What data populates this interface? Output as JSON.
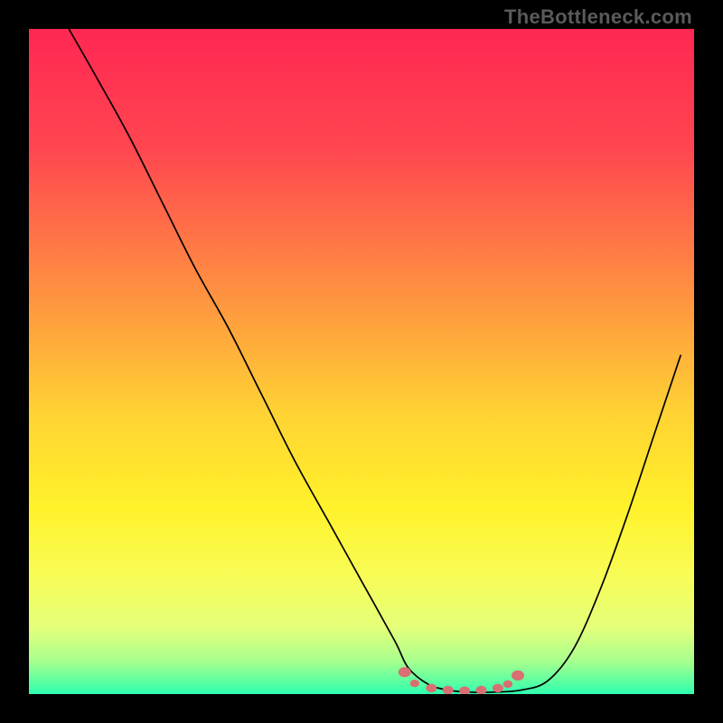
{
  "watermark": "TheBottleneck.com",
  "colors": {
    "gradient_stops": [
      {
        "pct": 0,
        "hex": "#ff2752"
      },
      {
        "pct": 18,
        "hex": "#ff4650"
      },
      {
        "pct": 38,
        "hex": "#ff8b42"
      },
      {
        "pct": 58,
        "hex": "#ffd333"
      },
      {
        "pct": 72,
        "hex": "#fff22a"
      },
      {
        "pct": 82,
        "hex": "#f8fc55"
      },
      {
        "pct": 90,
        "hex": "#e4ff7a"
      },
      {
        "pct": 95,
        "hex": "#a8ff8e"
      },
      {
        "pct": 98,
        "hex": "#5fffa0"
      },
      {
        "pct": 100,
        "hex": "#2fffb0"
      }
    ],
    "curve_stroke": "#000000",
    "marker_fill": "#d96f72",
    "background": "#000000"
  },
  "chart_data": {
    "type": "line",
    "title": "",
    "xlabel": "",
    "ylabel": "",
    "xlim": [
      0,
      100
    ],
    "ylim": [
      0,
      100
    ],
    "series": [
      {
        "name": "bottleneck-curve",
        "x": [
          6,
          10,
          15,
          20,
          25,
          30,
          35,
          40,
          45,
          50,
          55,
          57,
          60,
          63,
          66,
          70,
          74,
          78,
          82,
          86,
          90,
          94,
          98
        ],
        "y": [
          100,
          93,
          84,
          74,
          64,
          55,
          45,
          35,
          26,
          17,
          8,
          4,
          1.5,
          0.6,
          0.3,
          0.3,
          0.6,
          2,
          7,
          16,
          27,
          39,
          51
        ]
      }
    ],
    "markers": {
      "name": "optimal-range-markers",
      "x": [
        56.5,
        58,
        60.5,
        63,
        65.5,
        68,
        70.5,
        72,
        73.5
      ],
      "y": [
        3.3,
        1.6,
        0.9,
        0.6,
        0.5,
        0.6,
        0.9,
        1.5,
        2.8
      ],
      "r": [
        3.5,
        2.6,
        3.0,
        3.0,
        3.0,
        3.0,
        3.0,
        2.6,
        3.5
      ]
    }
  }
}
